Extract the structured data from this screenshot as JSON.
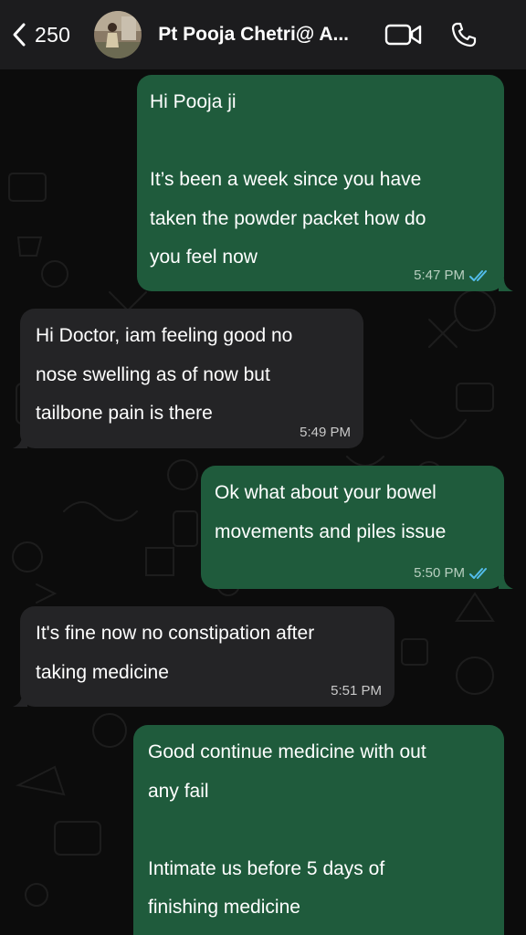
{
  "header": {
    "back_count": "250",
    "contact_name": "Pt Pooja Chetri@ A..."
  },
  "messages": [
    {
      "direction": "outgoing",
      "text": "Hi Pooja ji\n\nIt’s been a week since you have\ntaken the powder packet how do\nyou feel now",
      "time": "5:47 PM",
      "status": "read"
    },
    {
      "direction": "incoming",
      "text": "Hi Doctor, iam feeling good no\nnose swelling as of now but\ntailbone pain is there",
      "time": "5:49 PM"
    },
    {
      "direction": "outgoing",
      "text": "Ok what about your bowel\nmovements and piles issue",
      "time": "5:50 PM",
      "status": "read"
    },
    {
      "direction": "incoming",
      "text": "It's fine now no constipation after\ntaking medicine",
      "time": "5:51 PM"
    },
    {
      "direction": "outgoing",
      "text": "Good continue medicine with out\nany fail\n\nIntimate us before 5 days of\nfinishing medicine",
      "time": "",
      "status": ""
    }
  ],
  "colors": {
    "outgoing_bubble": "#1f5b3c",
    "incoming_bubble": "#242426",
    "read_ticks": "#53bdeb",
    "header_bg": "#1c1c1e"
  },
  "icons": [
    "chevron-left-icon",
    "video-call-icon",
    "phone-icon",
    "double-check-icon"
  ]
}
